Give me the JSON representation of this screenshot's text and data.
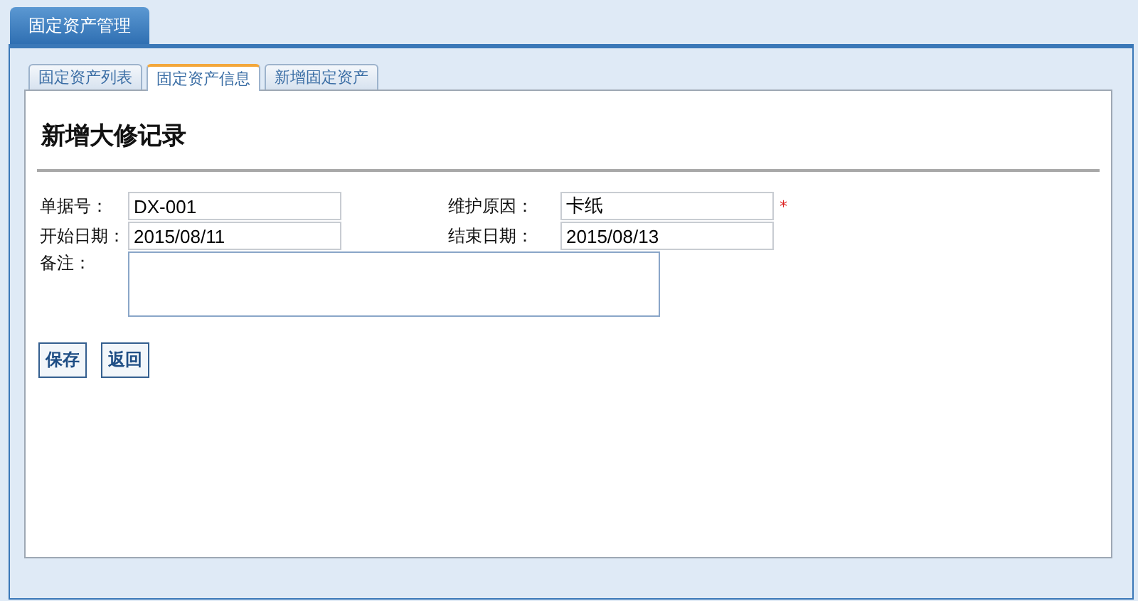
{
  "header_tab": {
    "label": "固定资产管理"
  },
  "tabs": [
    {
      "label": "固定资产列表",
      "selected": false
    },
    {
      "label": "固定资产信息",
      "selected": true
    },
    {
      "label": "新增固定资产",
      "selected": false
    }
  ],
  "form": {
    "title": "新增大修记录",
    "fields": [
      {
        "label": "单据号：",
        "value": "DX-001"
      },
      {
        "label": "维护原因：",
        "value": "卡纸",
        "required_mark": "*"
      },
      {
        "label": "开始日期：",
        "value": "2015/08/11"
      },
      {
        "label": "结束日期：",
        "value": "2015/08/13"
      }
    ],
    "remark": {
      "label": "备注："
    }
  },
  "buttons": [
    "保存",
    "返回"
  ]
}
